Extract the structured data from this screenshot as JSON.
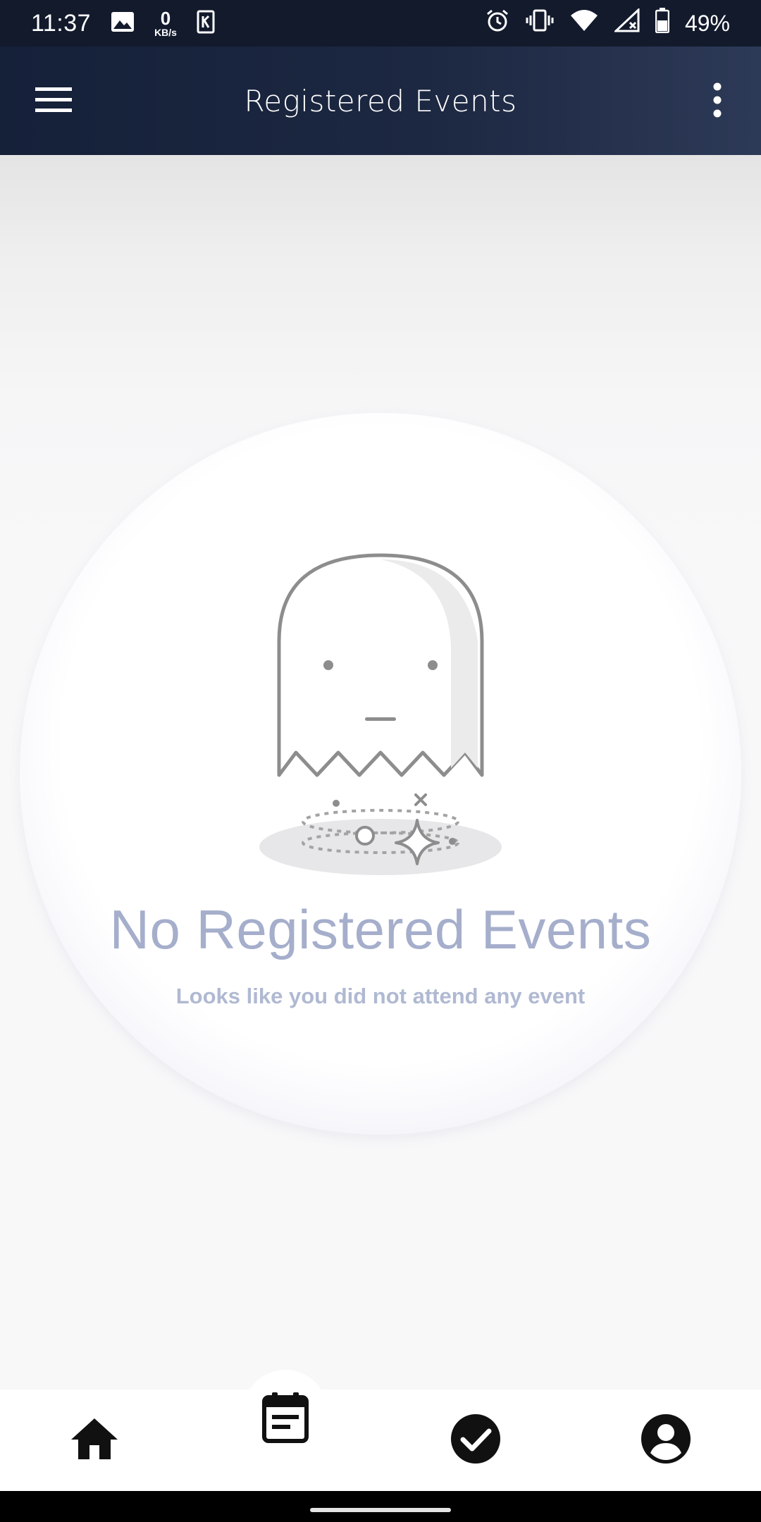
{
  "status_bar": {
    "time": "11:37",
    "net_speed_value": "0",
    "net_speed_unit": "KB/s",
    "battery": "49%",
    "icons": [
      "image-icon",
      "k-app-icon",
      "alarm-icon",
      "vibrate-icon",
      "wifi-icon",
      "signal-icon",
      "battery-icon"
    ]
  },
  "app_bar": {
    "title": "Registered Events",
    "menu_icon": "hamburger-menu-icon",
    "more_icon": "more-vert-icon"
  },
  "empty_state": {
    "title": "No Registered Events",
    "subtitle": "Looks like you did not attend any event",
    "illustration": "ghost-illustration"
  },
  "bottom_nav": {
    "items": [
      {
        "icon": "home-icon",
        "active": false
      },
      {
        "icon": "calendar-event-icon",
        "active": true
      },
      {
        "icon": "check-circle-icon",
        "active": false
      },
      {
        "icon": "account-circle-icon",
        "active": false
      }
    ]
  },
  "colors": {
    "status_bar_bg": "#121a2c",
    "app_bar_bg_start": "#152039",
    "app_bar_bg_end": "#2d3a57",
    "empty_title": "#a5aecb",
    "empty_subtitle": "#b0b9d2",
    "nav_icon": "#111111"
  }
}
